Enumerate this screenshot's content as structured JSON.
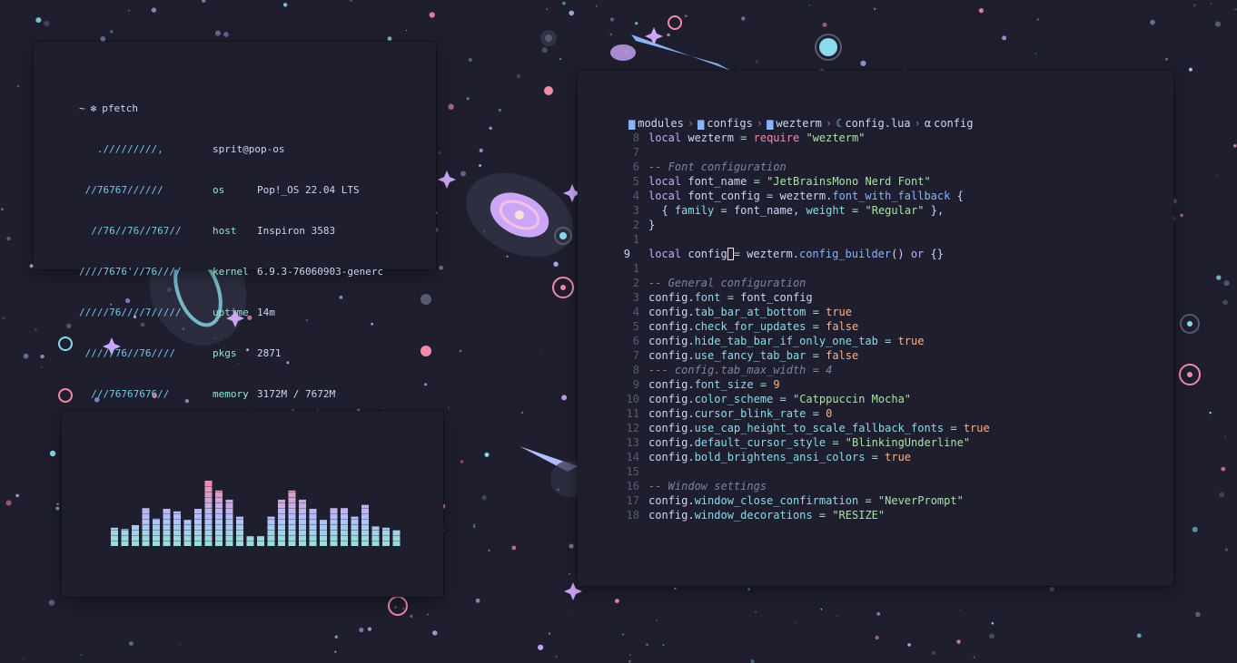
{
  "colors": {
    "background": "#1e1e2e",
    "text": "#cdd6f4",
    "accent_teal": "#94e2d5",
    "accent_sky": "#74c7ec",
    "accent_mauve": "#cba6f7",
    "accent_green": "#a6e3a1",
    "accent_peach": "#fab387",
    "accent_pink": "#f38ba8"
  },
  "pfetch": {
    "command": "pfetch",
    "prompt_symbol": "~",
    "prompt_icon": "gear-icon",
    "logo_lines": [
      "   ./////////,",
      " //76767//////",
      "  //76//76//767//",
      "////7676'//76////",
      "/////76////7/////",
      " /////76//76////",
      "  ///76767676//",
      "    `///////'"
    ],
    "user_host": "sprit@pop-os",
    "info": [
      {
        "key": "os",
        "value": "Pop!_OS 22.04 LTS"
      },
      {
        "key": "host",
        "value": "Inspiron 3583"
      },
      {
        "key": "kernel",
        "value": "6.9.3-76060903-generc"
      },
      {
        "key": "uptime",
        "value": "14m"
      },
      {
        "key": "pkgs",
        "value": "2871"
      },
      {
        "key": "memory",
        "value": "3172M / 7672M"
      }
    ]
  },
  "visualizer": {
    "bar_levels": [
      0.28,
      0.26,
      0.32,
      0.58,
      0.42,
      0.57,
      0.53,
      0.4,
      0.57,
      1.0,
      0.85,
      0.71,
      0.45,
      0.15,
      0.15,
      0.45,
      0.71,
      0.85,
      0.71,
      0.57,
      0.4,
      0.58,
      0.58,
      0.45,
      0.63,
      0.3,
      0.28,
      0.24
    ],
    "color_bottom": "#94e2d5",
    "color_mid": "#b4befe",
    "color_top": "#f38ba8"
  },
  "editor": {
    "breadcrumb": [
      {
        "icon": "folder-icon",
        "label": "modules"
      },
      {
        "icon": "folder-icon",
        "label": "configs"
      },
      {
        "icon": "folder-icon",
        "label": "wezterm"
      },
      {
        "icon": "lua-file-icon",
        "label": "config.lua"
      },
      {
        "icon": "alpha-icon",
        "label": "config"
      }
    ],
    "lines": [
      {
        "num": "8",
        "tokens": [
          [
            "kw",
            "local"
          ],
          [
            "id",
            " wezterm "
          ],
          [
            "op",
            "="
          ],
          [
            "id",
            " "
          ],
          [
            "rq",
            "require"
          ],
          [
            "id",
            " "
          ],
          [
            "str",
            "\"wezterm\""
          ]
        ]
      },
      {
        "num": "7",
        "tokens": []
      },
      {
        "num": "6",
        "tokens": [
          [
            "cm",
            "-- Font configuration"
          ]
        ]
      },
      {
        "num": "5",
        "tokens": [
          [
            "kw",
            "local"
          ],
          [
            "id",
            " font_name "
          ],
          [
            "op",
            "="
          ],
          [
            "id",
            " "
          ],
          [
            "str",
            "\"JetBrainsMono Nerd Font\""
          ]
        ]
      },
      {
        "num": "4",
        "tokens": [
          [
            "kw",
            "local"
          ],
          [
            "id",
            " font_config "
          ],
          [
            "op",
            "="
          ],
          [
            "id",
            " wezterm."
          ],
          [
            "fn",
            "font_with_fallback"
          ],
          [
            "id",
            " {"
          ]
        ]
      },
      {
        "num": "3",
        "tokens": [
          [
            "id",
            "  { "
          ],
          [
            "prop",
            "family"
          ],
          [
            "id",
            " "
          ],
          [
            "op",
            "="
          ],
          [
            "id",
            " font_name, "
          ],
          [
            "prop",
            "weight"
          ],
          [
            "id",
            " "
          ],
          [
            "op",
            "="
          ],
          [
            "id",
            " "
          ],
          [
            "str",
            "\"Regular\""
          ],
          [
            "id",
            " },"
          ]
        ]
      },
      {
        "num": "2",
        "tokens": [
          [
            "id",
            "}"
          ]
        ]
      },
      {
        "num": "1",
        "tokens": []
      },
      {
        "num": "9",
        "current": true,
        "tokens": [
          [
            "kw",
            "local"
          ],
          [
            "id",
            " config"
          ],
          [
            "cursor",
            ""
          ],
          [
            "op",
            "="
          ],
          [
            "id",
            " wezterm."
          ],
          [
            "fn",
            "config_builder"
          ],
          [
            "id",
            "() "
          ],
          [
            "kw",
            "or"
          ],
          [
            "id",
            " {}"
          ]
        ]
      },
      {
        "num": "1",
        "tokens": []
      },
      {
        "num": "2",
        "tokens": [
          [
            "cm",
            "-- General configuration"
          ]
        ]
      },
      {
        "num": "3",
        "tokens": [
          [
            "id",
            "config."
          ],
          [
            "prop",
            "font"
          ],
          [
            "id",
            " "
          ],
          [
            "op",
            "="
          ],
          [
            "id",
            " font_config"
          ]
        ]
      },
      {
        "num": "4",
        "tokens": [
          [
            "id",
            "config."
          ],
          [
            "prop",
            "tab_bar_at_bottom"
          ],
          [
            "id",
            " "
          ],
          [
            "op",
            "="
          ],
          [
            "id",
            " "
          ],
          [
            "bool",
            "true"
          ]
        ]
      },
      {
        "num": "5",
        "tokens": [
          [
            "id",
            "config."
          ],
          [
            "prop",
            "check_for_updates"
          ],
          [
            "id",
            " "
          ],
          [
            "op",
            "="
          ],
          [
            "id",
            " "
          ],
          [
            "bool",
            "false"
          ]
        ]
      },
      {
        "num": "6",
        "tokens": [
          [
            "id",
            "config."
          ],
          [
            "prop",
            "hide_tab_bar_if_only_one_tab"
          ],
          [
            "id",
            " "
          ],
          [
            "op",
            "="
          ],
          [
            "id",
            " "
          ],
          [
            "bool",
            "true"
          ]
        ]
      },
      {
        "num": "7",
        "tokens": [
          [
            "id",
            "config."
          ],
          [
            "prop",
            "use_fancy_tab_bar"
          ],
          [
            "id",
            " "
          ],
          [
            "op",
            "="
          ],
          [
            "id",
            " "
          ],
          [
            "bool",
            "false"
          ]
        ]
      },
      {
        "num": "8",
        "tokens": [
          [
            "cm",
            "--- config.tab_max_width = 4"
          ]
        ]
      },
      {
        "num": "9",
        "tokens": [
          [
            "id",
            "config."
          ],
          [
            "prop",
            "font_size"
          ],
          [
            "id",
            " "
          ],
          [
            "op",
            "="
          ],
          [
            "id",
            " "
          ],
          [
            "num",
            "9"
          ]
        ]
      },
      {
        "num": "10",
        "tokens": [
          [
            "id",
            "config."
          ],
          [
            "prop",
            "color_scheme"
          ],
          [
            "id",
            " "
          ],
          [
            "op",
            "="
          ],
          [
            "id",
            " "
          ],
          [
            "str",
            "\"Catppuccin Mocha\""
          ]
        ]
      },
      {
        "num": "11",
        "tokens": [
          [
            "id",
            "config."
          ],
          [
            "prop",
            "cursor_blink_rate"
          ],
          [
            "id",
            " "
          ],
          [
            "op",
            "="
          ],
          [
            "id",
            " "
          ],
          [
            "num",
            "0"
          ]
        ]
      },
      {
        "num": "12",
        "tokens": [
          [
            "id",
            "config."
          ],
          [
            "prop",
            "use_cap_height_to_scale_fallback_fonts"
          ],
          [
            "id",
            " "
          ],
          [
            "op",
            "="
          ],
          [
            "id",
            " "
          ],
          [
            "bool",
            "true"
          ]
        ]
      },
      {
        "num": "13",
        "tokens": [
          [
            "id",
            "config."
          ],
          [
            "prop",
            "default_cursor_style"
          ],
          [
            "id",
            " "
          ],
          [
            "op",
            "="
          ],
          [
            "id",
            " "
          ],
          [
            "str",
            "\"BlinkingUnderline\""
          ]
        ]
      },
      {
        "num": "14",
        "tokens": [
          [
            "id",
            "config."
          ],
          [
            "prop",
            "bold_brightens_ansi_colors"
          ],
          [
            "id",
            " "
          ],
          [
            "op",
            "="
          ],
          [
            "id",
            " "
          ],
          [
            "bool",
            "true"
          ]
        ]
      },
      {
        "num": "15",
        "tokens": []
      },
      {
        "num": "16",
        "tokens": [
          [
            "cm",
            "-- Window settings"
          ]
        ]
      },
      {
        "num": "17",
        "tokens": [
          [
            "id",
            "config."
          ],
          [
            "prop",
            "window_close_confirmation"
          ],
          [
            "id",
            " "
          ],
          [
            "op",
            "="
          ],
          [
            "id",
            " "
          ],
          [
            "str",
            "\"NeverPrompt\""
          ]
        ]
      },
      {
        "num": "18",
        "tokens": [
          [
            "id",
            "config."
          ],
          [
            "prop",
            "window_decorations"
          ],
          [
            "id",
            " "
          ],
          [
            "op",
            "="
          ],
          [
            "id",
            " "
          ],
          [
            "str",
            "\"RESIZE\""
          ]
        ]
      }
    ]
  }
}
